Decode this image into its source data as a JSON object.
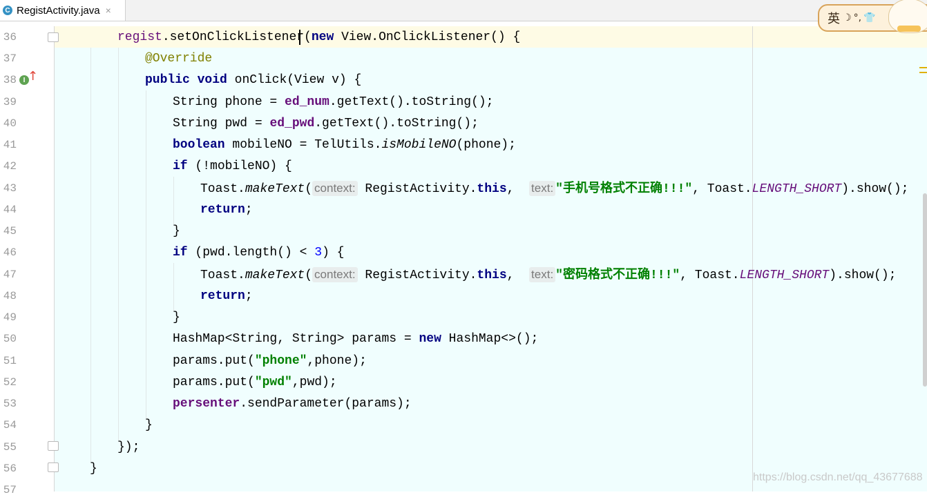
{
  "tab": {
    "icon_letter": "C",
    "label": "RegistActivity.java",
    "close_glyph": "×"
  },
  "ime": {
    "lang": "英",
    "icon1": "☽",
    "icon2": "°,",
    "icon3": "👕"
  },
  "gutter": {
    "line_numbers": [
      "36",
      "37",
      "38",
      "39",
      "40",
      "41",
      "42",
      "43",
      "44",
      "45",
      "46",
      "47",
      "48",
      "49",
      "50",
      "51",
      "52",
      "53",
      "54",
      "55",
      "56",
      "57"
    ],
    "impl_letter": "I",
    "impl_arrow": "↑"
  },
  "code": {
    "l36": {
      "a": "regist",
      "b": ".setOnClickListener(",
      "c": "new",
      "d": " View.OnClickListener() {"
    },
    "l37": {
      "a": "@Override"
    },
    "l38": {
      "a": "public",
      "b": " ",
      "c": "void",
      "d": " onClick(View v) {"
    },
    "l39": {
      "a": "String phone = ",
      "b": "ed_num",
      "c": ".getText().toString();"
    },
    "l40": {
      "a": "String pwd = ",
      "b": "ed_pwd",
      "c": ".getText().toString();"
    },
    "l41": {
      "a": "boolean",
      "b": " mobileNO = TelUtils.",
      "c": "isMobileNO",
      "d": "(phone);"
    },
    "l42": {
      "a": "if",
      "b": " (!mobileNO) {"
    },
    "l43": {
      "a": "Toast.",
      "b": "makeText",
      "c": "(",
      "hint1": "context:",
      "d": " RegistActivity.",
      "e": "this",
      "f": ",  ",
      "hint2": "text:",
      "g": "\"手机号格式不正确!!!\"",
      "h": ", Toast.",
      "i": "LENGTH_SHORT",
      "j": ").show();"
    },
    "l44": {
      "a": "return",
      "b": ";"
    },
    "l45": {
      "a": "}"
    },
    "l46": {
      "a": "if",
      "b": " (pwd.length() < ",
      "c": "3",
      "d": ") {"
    },
    "l47": {
      "a": "Toast.",
      "b": "makeText",
      "c": "(",
      "hint1": "context:",
      "d": " RegistActivity.",
      "e": "this",
      "f": ",  ",
      "hint2": "text:",
      "g": "\"密码格式不正确!!!\"",
      "h": ", Toast.",
      "i": "LENGTH_SHORT",
      "j": ").show();"
    },
    "l48": {
      "a": "return",
      "b": ";"
    },
    "l49": {
      "a": "}"
    },
    "l50": {
      "a": "HashMap<String, String> params = ",
      "b": "new",
      "c": " HashMap<>();"
    },
    "l51": {
      "a": "params.put(",
      "b": "\"phone\"",
      "c": ",phone);"
    },
    "l52": {
      "a": "params.put(",
      "b": "\"pwd\"",
      "c": ",pwd);"
    },
    "l53": {
      "a": "persenter",
      "b": ".sendParameter(params);"
    },
    "l54": {
      "a": "}"
    },
    "l55": {
      "a": "});"
    },
    "l56": {
      "a": "}"
    }
  },
  "watermark": "https://blog.csdn.net/qq_43677688"
}
